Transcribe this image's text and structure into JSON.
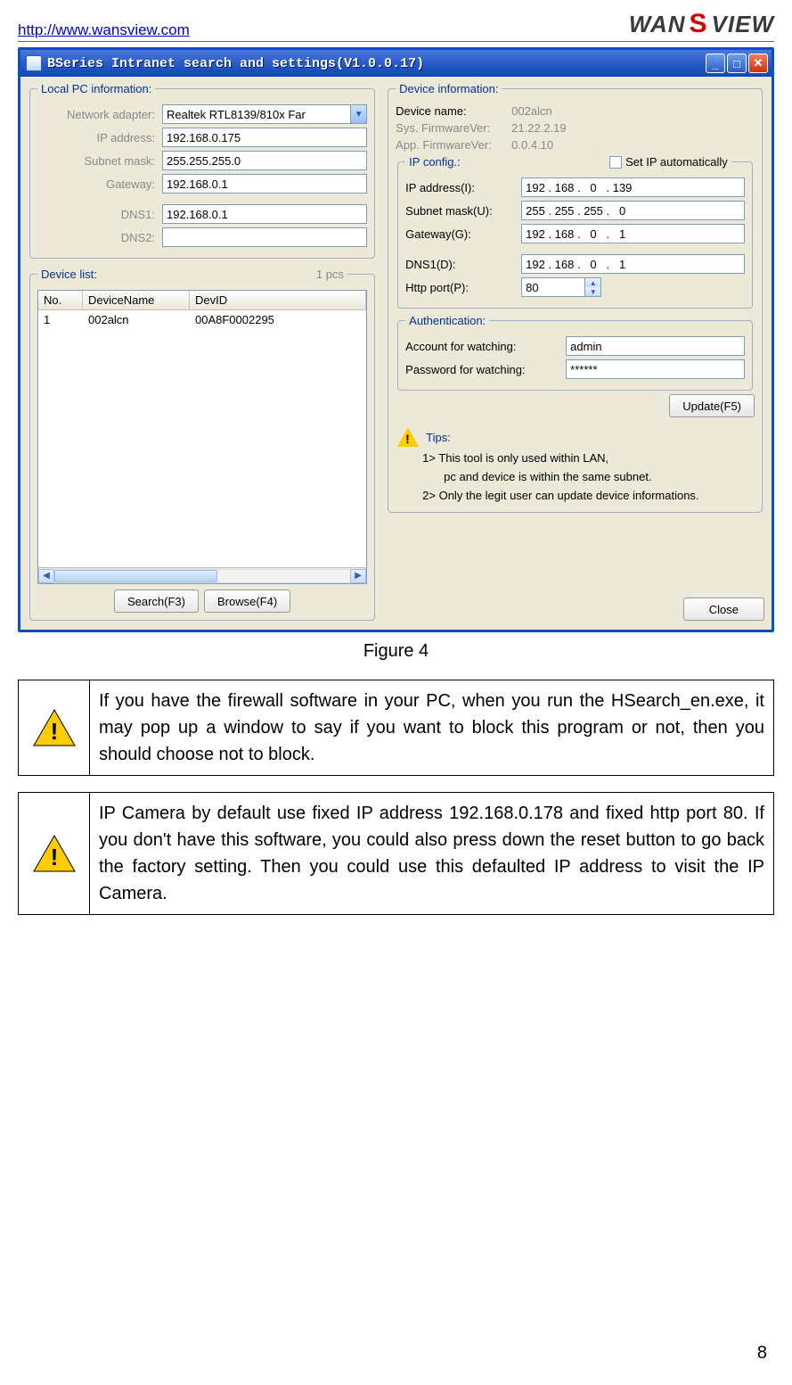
{
  "header": {
    "url": "http://www.wansview.com",
    "brand_pre": "WAN",
    "brand_mid": "S",
    "brand_post": "VIEW"
  },
  "window": {
    "title": "BSeries Intranet search and settings(V1.0.0.17)"
  },
  "local_pc": {
    "legend": "Local PC information:",
    "network_adapter_label": "Network adapter:",
    "network_adapter_value": "Realtek RTL8139/810x Far",
    "ip_label": "IP address:",
    "ip_value": "192.168.0.175",
    "subnet_label": "Subnet mask:",
    "subnet_value": "255.255.255.0",
    "gateway_label": "Gateway:",
    "gateway_value": "192.168.0.1",
    "dns1_label": "DNS1:",
    "dns1_value": "192.168.0.1",
    "dns2_label": "DNS2:",
    "dns2_value": ""
  },
  "device_list": {
    "legend": "Device list:",
    "count": "1 pcs",
    "col_no": "No.",
    "col_name": "DeviceName",
    "col_id": "DevID",
    "rows": [
      {
        "no": "1",
        "name": "002alcn",
        "id": "00A8F0002295"
      }
    ]
  },
  "buttons": {
    "search": "Search(F3)",
    "browse": "Browse(F4)",
    "update": "Update(F5)",
    "close": "Close"
  },
  "device_info": {
    "legend": "Device information:",
    "name_label": "Device name:",
    "name_value": "002alcn",
    "sysfw_label": "Sys. FirmwareVer:",
    "sysfw_value": "21.22.2.19",
    "appfw_label": "App. FirmwareVer:",
    "appfw_value": "0.0.4.10"
  },
  "ip_config": {
    "legend": "IP config.:",
    "auto_label": "Set IP automatically",
    "ip_label": "IP address(I):",
    "ip_value": "192 . 168 .   0   . 139",
    "subnet_label": "Subnet mask(U):",
    "subnet_value": "255 . 255 . 255 .   0",
    "gateway_label": "Gateway(G):",
    "gateway_value": "192 . 168 .   0   .   1",
    "dns1_label": "DNS1(D):",
    "dns1_value": "192 . 168 .   0   .   1",
    "port_label": "Http port(P):",
    "port_value": "80"
  },
  "auth": {
    "legend": "Authentication:",
    "account_label": "Account for watching:",
    "account_value": "admin",
    "password_label": "Password for watching:",
    "password_value": "******"
  },
  "tips": {
    "heading": "Tips:",
    "line1": "1> This tool is only used within LAN,",
    "line1b": "pc and device is within the same subnet.",
    "line2": "2> Only the legit user can update  device informations."
  },
  "figure_caption": "Figure 4",
  "note1": "If you have the firewall software in your PC, when you run the HSearch_en.exe, it may pop up a window to say if you want to block this program or not, then you should choose not to block.",
  "note2": "IP Camera by default use fixed IP address 192.168.0.178 and fixed http port 80. If you don't have this software, you could also press down the reset button to go back the factory setting. Then you could use this defaulted IP address to visit the IP Camera.",
  "page_number": "8"
}
